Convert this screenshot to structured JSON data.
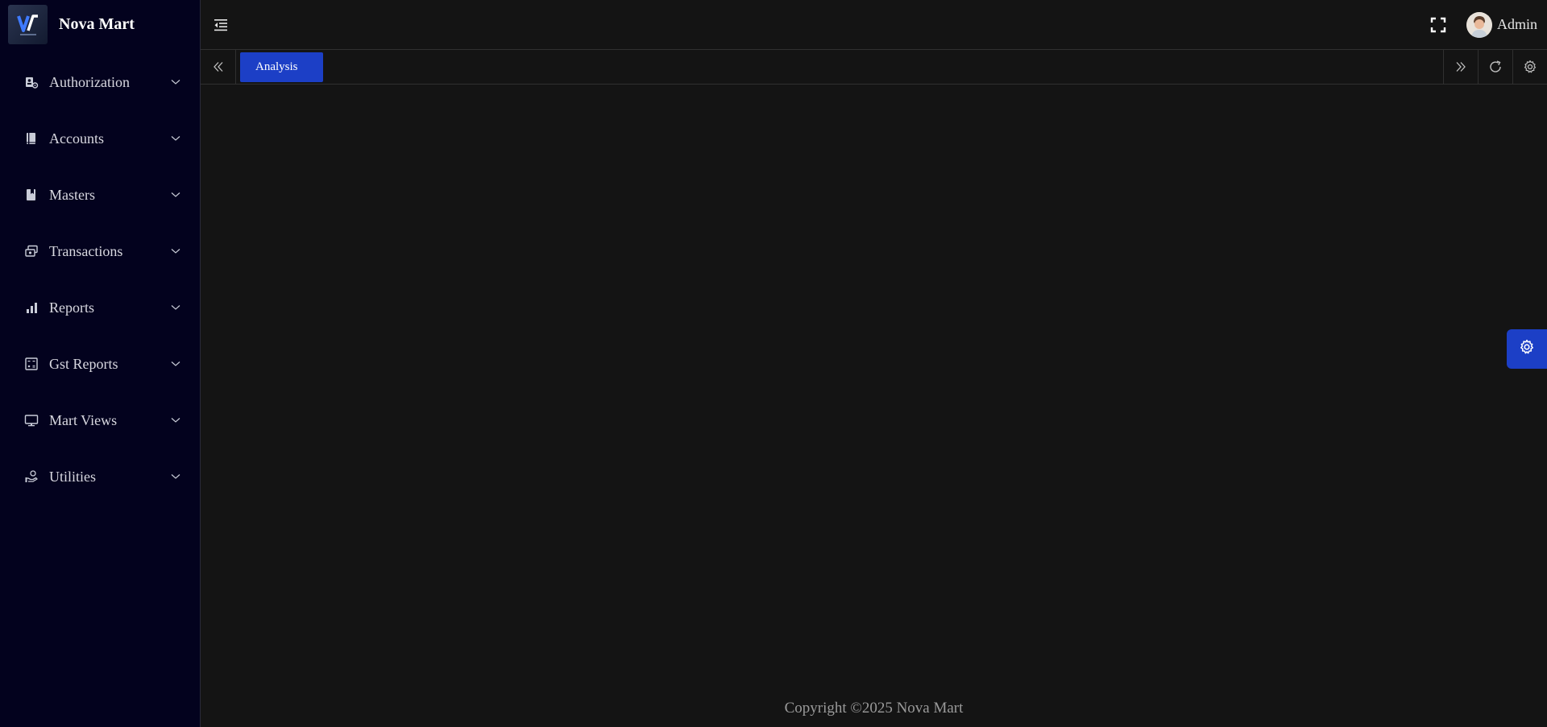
{
  "brand": {
    "name": "Nova Mart"
  },
  "sidebar": {
    "items": [
      {
        "label": "Authorization",
        "icon": "user-lock-icon"
      },
      {
        "label": "Accounts",
        "icon": "book-icon"
      },
      {
        "label": "Masters",
        "icon": "bookmark-book-icon"
      },
      {
        "label": "Transactions",
        "icon": "transactions-icon"
      },
      {
        "label": "Reports",
        "icon": "bar-chart-icon"
      },
      {
        "label": "Gst Reports",
        "icon": "calculator-icon"
      },
      {
        "label": "Mart Views",
        "icon": "monitor-icon"
      },
      {
        "label": "Utilities",
        "icon": "hand-coin-icon"
      }
    ]
  },
  "header": {
    "user_name": "Admin"
  },
  "tabs": [
    {
      "label": "Analysis",
      "active": true
    }
  ],
  "footer": {
    "copyright": "Copyright ©2025 Nova Mart"
  },
  "colors": {
    "sidebar_bg": "#03021e",
    "main_bg": "#141414",
    "accent": "#1c3fc6"
  }
}
